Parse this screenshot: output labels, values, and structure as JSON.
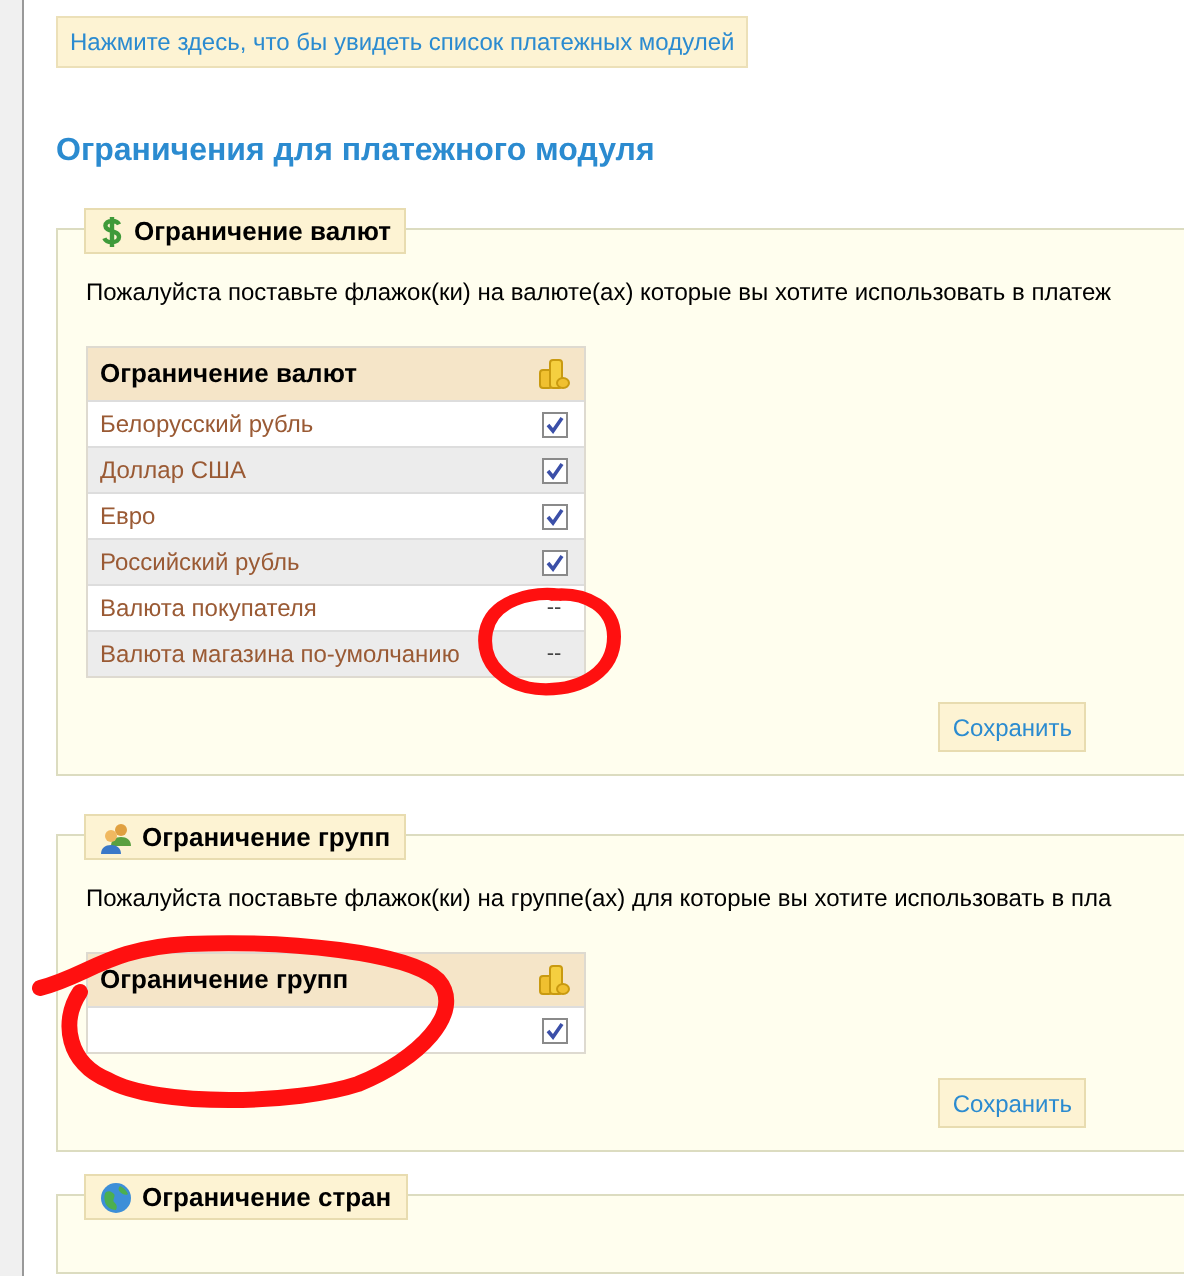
{
  "modules_link": "Нажмите здесь, что бы увидеть список платежных модулей",
  "heading": "Ограничения для платежного модуля",
  "sections": [
    {
      "kind": "currency",
      "legend": "Ограничение валют",
      "instruction": "Пожалуйста поставьте флажок(ки) на валюте(ах) которые вы хотите использовать в платеж",
      "table_header": "Ограничение валют",
      "rows": [
        {
          "label": "Белорусский рубль",
          "kind": "checkbox",
          "checked": true
        },
        {
          "label": "Доллар США",
          "kind": "checkbox",
          "checked": true
        },
        {
          "label": "Евро",
          "kind": "checkbox",
          "checked": true
        },
        {
          "label": "Российский рубль",
          "kind": "checkbox",
          "checked": true
        },
        {
          "label": "Валюта покупателя",
          "kind": "text",
          "value": "--"
        },
        {
          "label": "Валюта магазина по-умолчанию",
          "kind": "text",
          "value": "--"
        }
      ],
      "save": "Сохранить"
    },
    {
      "kind": "groups",
      "legend": "Ограничение групп",
      "instruction": "Пожалуйста поставьте флажок(ки) на группе(ах) для которые вы хотите использовать в пла",
      "table_header": "Ограничение групп",
      "rows": [
        {
          "kind": "checkbox",
          "checked": true
        }
      ],
      "save": "Сохранить"
    },
    {
      "kind": "countries",
      "legend": "Ограничение стран"
    }
  ]
}
